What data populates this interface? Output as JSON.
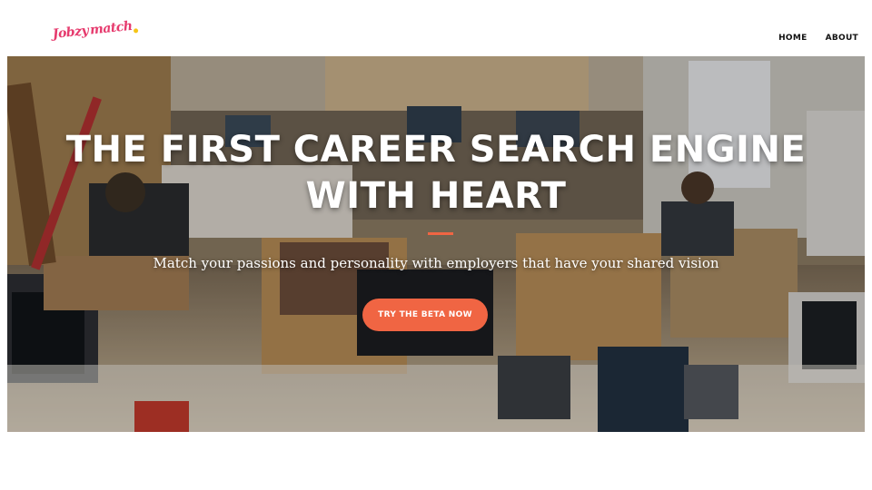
{
  "brand": {
    "logo_line1": "Jobzy",
    "logo_line2": "match"
  },
  "nav": {
    "items": [
      {
        "label": "HOME"
      },
      {
        "label": "ABOUT"
      }
    ]
  },
  "hero": {
    "headline_line1": "THE FIRST CAREER SEARCH ENGINE",
    "headline_line2": "WITH HEART",
    "subtitle": "Match your passions and personality with employers that have your shared vision",
    "cta_label": "TRY THE BETA NOW"
  },
  "colors": {
    "accent": "#f06543",
    "logo": "#e63a6d",
    "logo_dot": "#f5c518",
    "nav_text": "#111111"
  },
  "icons": {
    "background": "office-photo"
  }
}
